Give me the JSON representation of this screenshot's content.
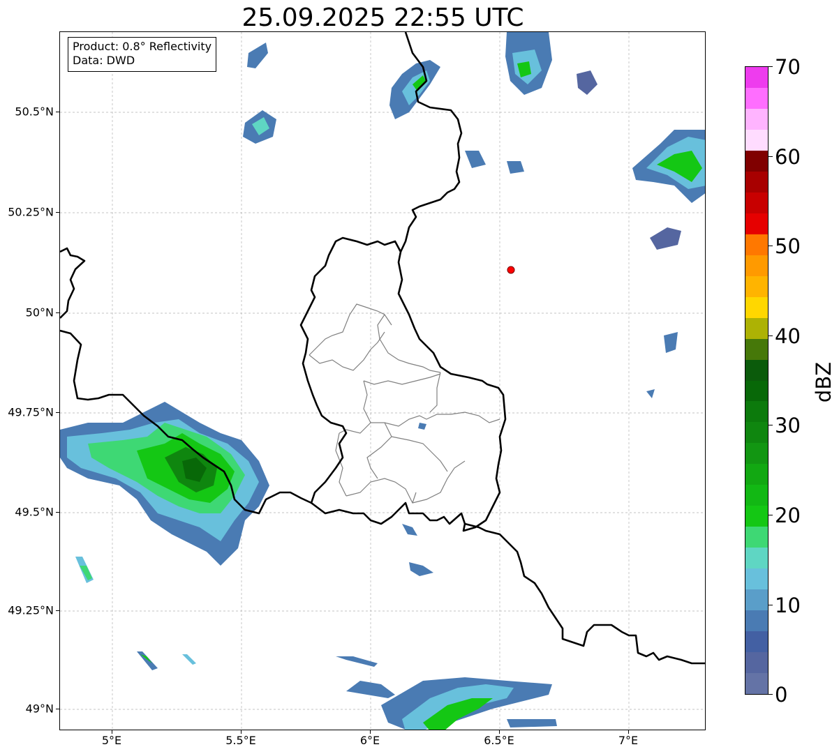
{
  "title": "25.09.2025 22:55 UTC",
  "info_box": {
    "product_line": "Product: 0.8° Reflectivity",
    "data_line": "Data: DWD"
  },
  "axes": {
    "lon_labels": [
      "5°E",
      "5.5°E",
      "6°E",
      "6.5°E",
      "7°E"
    ],
    "lat_labels": [
      "50.5°N",
      "50.25°N",
      "50°N",
      "49.75°N",
      "49.5°N",
      "49.25°N",
      "49°N"
    ],
    "grid": true
  },
  "colorbar": {
    "unit": "dBZ",
    "min": 0,
    "max": 70,
    "tick_labels": [
      "0",
      "10",
      "20",
      "30",
      "40",
      "50",
      "60",
      "70"
    ],
    "colors": [
      "#6473a6",
      "#5566a0",
      "#4360a3",
      "#4a7bb3",
      "#5a9ec9",
      "#68c0dc",
      "#5fd6c3",
      "#3ed874",
      "#14c714",
      "#12b814",
      "#12a812",
      "#129612",
      "#0f860f",
      "#0c7a0c",
      "#086808",
      "#0b5b0b",
      "#467809",
      "#adb204",
      "#ffd700",
      "#ffb400",
      "#ff9a00",
      "#ff7800",
      "#e60000",
      "#c80000",
      "#a80000",
      "#800000",
      "#ffdcff",
      "#ffb4ff",
      "#ff6eff",
      "#ee3cee"
    ]
  },
  "marker": {
    "label": "radar-site",
    "color": "#ff0000"
  }
}
